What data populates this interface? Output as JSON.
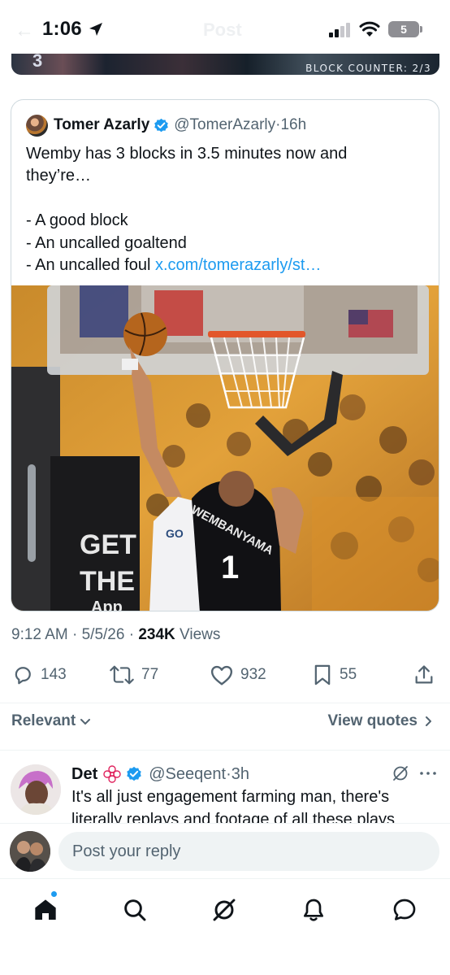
{
  "status_bar": {
    "time": "1:06",
    "battery": "5",
    "ghost_title": "Post"
  },
  "top_media": {
    "jersey_number": "3",
    "overlay_label": "BLOCK COUNTER: 2/3"
  },
  "quoted_post": {
    "author_name": "Tomer Azarly",
    "handle": "@TomerAzarly",
    "separator": " · ",
    "time": "16h",
    "text_lines": [
      "Wemby has 3 blocks in 3.5 minutes now and",
      "they’re…",
      "",
      "- A good block",
      "- An uncalled goaltend",
      "- An uncalled foul "
    ],
    "link_text": "x.com/tomerazarly/st…",
    "media_texts": {
      "jersey_name": "WEMBANYAMA",
      "jersey_number": "1",
      "ad_line1": "GET",
      "ad_line2": "THE",
      "ad_line3": "App",
      "opponent_text": "GO"
    }
  },
  "meta": {
    "time": "9:12 AM",
    "sep1": " · ",
    "date": "5/5/26",
    "sep2": " · ",
    "views_count": "234K",
    "views_label": " Views"
  },
  "actions": {
    "replies": "143",
    "reposts": "77",
    "likes": "932",
    "bookmarks": "55"
  },
  "sort": {
    "left_label": "Relevant",
    "right_label": "View quotes"
  },
  "reply": {
    "name": "Det",
    "handle": "@Seeqent",
    "separator": " · ",
    "time": "3h",
    "text_line1": "It's all just engagement farming man, there's",
    "text_line2": "literally replays and footage of all these plays"
  },
  "composer": {
    "placeholder": "Post your reply"
  },
  "colors": {
    "accent": "#1d9bf0",
    "text_secondary": "#536471",
    "divider": "#eff3f4"
  },
  "icons": [
    "location-arrow-icon",
    "signal-icon",
    "wifi-icon",
    "battery-icon",
    "verified-badge-icon",
    "reply-icon",
    "repost-icon",
    "like-icon",
    "bookmark-icon",
    "share-icon",
    "chevron-down-icon",
    "chevron-right-icon",
    "grok-icon",
    "more-icon",
    "home-icon",
    "search-icon",
    "notifications-icon",
    "messages-icon"
  ]
}
